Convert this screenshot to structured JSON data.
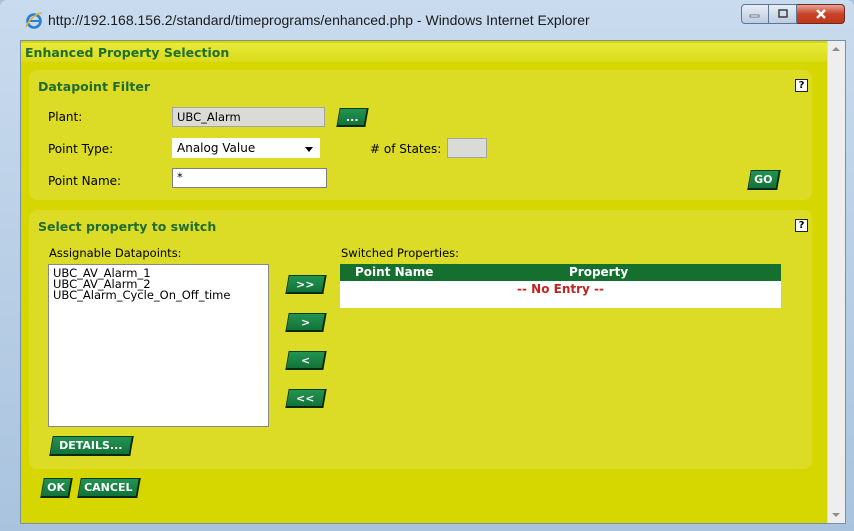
{
  "window": {
    "title": "http://192.168.156.2/standard/timeprograms/enhanced.php - Windows Internet Explorer",
    "frame_color": "#a9c3de",
    "close_color": "#c7432a"
  },
  "page": {
    "header": "Enhanced Property Selection",
    "background_color": "#d6d600",
    "accent_green": "#15702f"
  },
  "filter": {
    "title": "Datapoint Filter",
    "help": "?",
    "plant_label": "Plant:",
    "plant_value": "UBC_Alarm",
    "plant_browse_label": "...",
    "point_type_label": "Point Type:",
    "point_type_value": "Analog Value",
    "states_label": "# of States:",
    "states_value": "",
    "point_name_label": "Point Name:",
    "point_name_value": "*",
    "go_label": "GO"
  },
  "select": {
    "title": "Select property to switch",
    "help": "?",
    "assignable_label": "Assignable Datapoints:",
    "assignable_items": [
      "UBC_AV_Alarm_1",
      "UBC_AV_Alarm_2",
      "UBC_Alarm_Cycle_On_Off_time"
    ],
    "move_all_right": ">>",
    "move_right": ">",
    "move_left": "<",
    "move_all_left": "<<",
    "details_label": "DETAILS...",
    "switched_label": "Switched Properties:",
    "col_point_name": "Point Name",
    "col_property": "Property",
    "empty_text": "-- No Entry --"
  },
  "footer": {
    "ok_label": "OK",
    "cancel_label": "CANCEL"
  }
}
